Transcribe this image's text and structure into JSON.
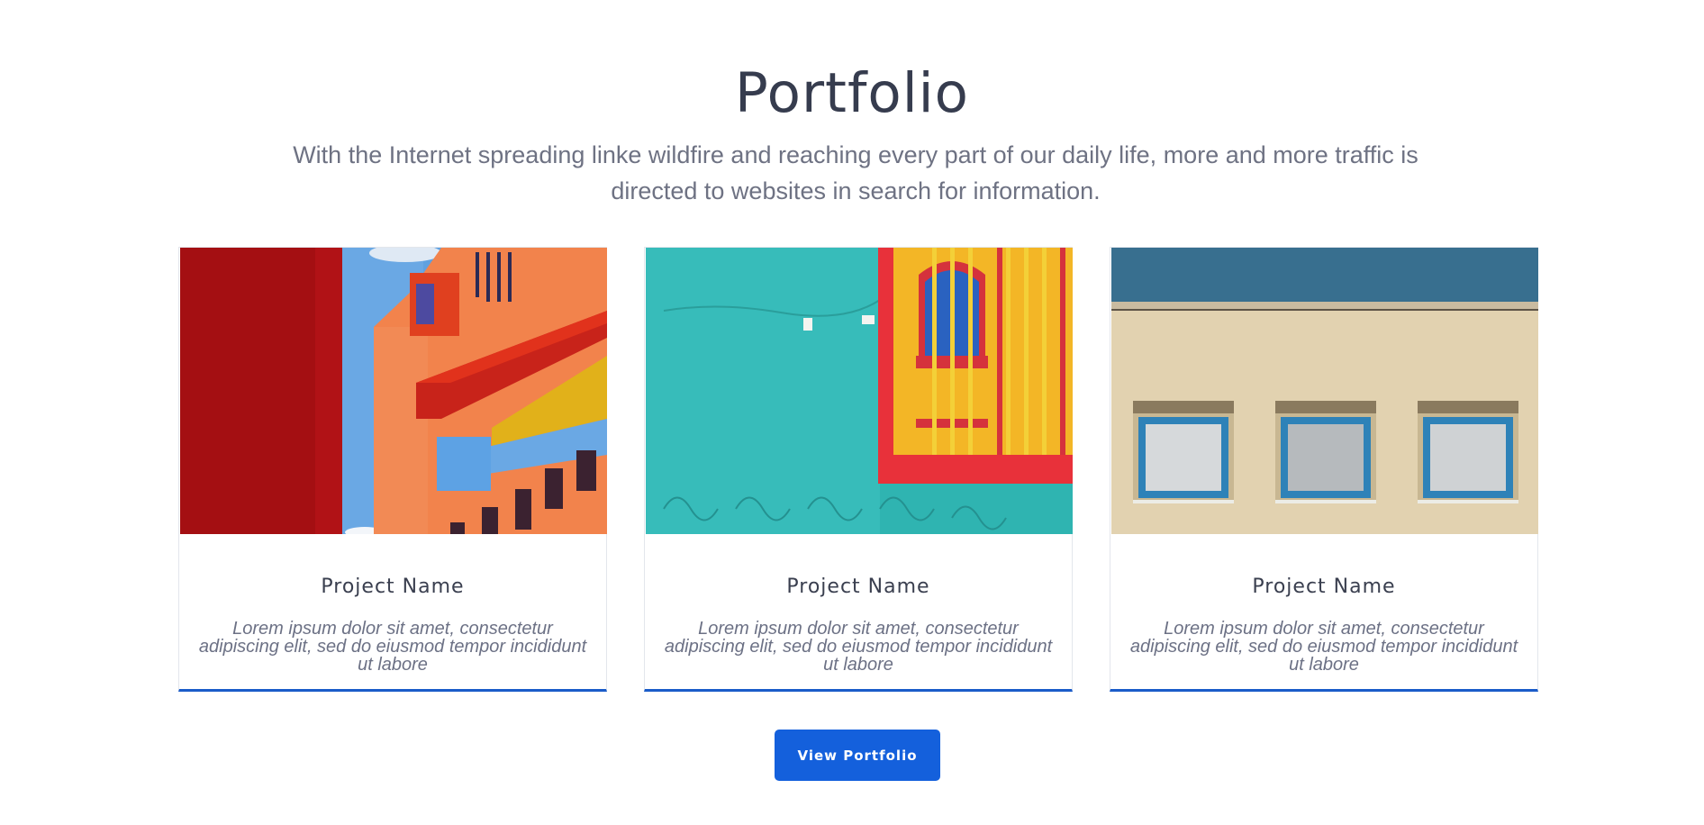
{
  "section": {
    "title": "Portfolio",
    "subtitle": "With the Internet spreading linke wildfire and reaching every part of our daily life, more and more traffic is directed to websites in search for information."
  },
  "projects": [
    {
      "image": "red-orange-building-photo",
      "name": "Project Name",
      "description": "Lorem ipsum dolor sit amet, consectetur adipiscing elit, sed do eiusmod tempor incididunt ut labore"
    },
    {
      "image": "turquoise-wall-ornate-window-photo",
      "name": "Project Name",
      "description": "Lorem ipsum dolor sit amet, consectetur adipiscing elit, sed do eiusmod tempor incididunt ut labore"
    },
    {
      "image": "beige-facade-blue-windows-photo",
      "name": "Project Name",
      "description": "Lorem ipsum dolor sit amet, consectetur adipiscing elit, sed do eiusmod tempor incididunt ut labore"
    }
  ],
  "cta": {
    "label": "View Portfolio"
  },
  "colors": {
    "accent": "#1460dc",
    "card_border_bottom": "#1a5cc9",
    "title": "#363c4e",
    "body_text": "#6e7283"
  }
}
